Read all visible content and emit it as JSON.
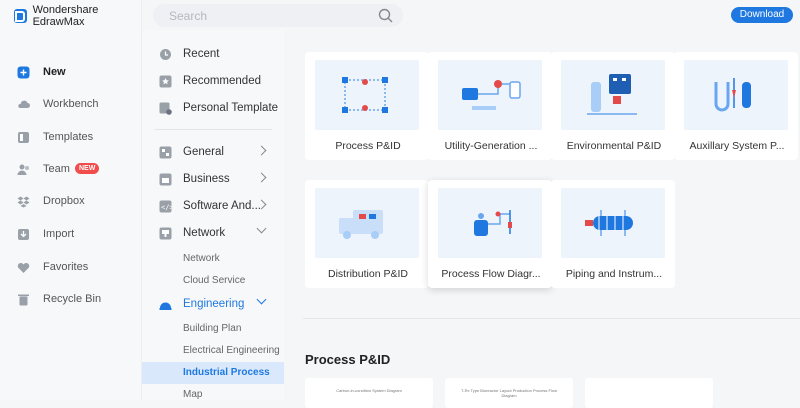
{
  "app": {
    "name": "Wondershare EdrawMax"
  },
  "leftnav": {
    "items": [
      {
        "label": "New",
        "icon": "plus-square-icon",
        "active": true
      },
      {
        "label": "Workbench",
        "icon": "cloud-icon"
      },
      {
        "label": "Templates",
        "icon": "template-icon"
      },
      {
        "label": "Team",
        "icon": "team-icon",
        "badge": "NEW"
      },
      {
        "label": "Dropbox",
        "icon": "dropbox-icon"
      },
      {
        "label": "Import",
        "icon": "import-icon"
      },
      {
        "label": "Favorites",
        "icon": "heart-icon"
      },
      {
        "label": "Recycle Bin",
        "icon": "trash-icon"
      }
    ]
  },
  "search": {
    "placeholder": "Search"
  },
  "download": {
    "label": "Download"
  },
  "categories": {
    "top": [
      {
        "label": "Recent",
        "icon": "clock-icon"
      },
      {
        "label": "Recommended",
        "icon": "star-icon"
      },
      {
        "label": "Personal Template",
        "icon": "personal-template-icon"
      }
    ],
    "groups": [
      {
        "label": "General",
        "icon": "general-icon"
      },
      {
        "label": "Business",
        "icon": "business-icon"
      },
      {
        "label": "Software And...",
        "icon": "software-icon"
      },
      {
        "label": "Network",
        "icon": "network-icon"
      }
    ],
    "network_subs": [
      "Network",
      "Cloud Service"
    ],
    "engineering": {
      "label": "Engineering",
      "icon": "engineering-icon"
    },
    "engineering_subs": [
      "Building Plan",
      "Electrical Engineering",
      "Industrial Process",
      "Map"
    ],
    "active_sub": "Industrial Process"
  },
  "templates": [
    {
      "title": "Process P&ID"
    },
    {
      "title": "Utility-Generation ..."
    },
    {
      "title": "Environmental P&ID"
    },
    {
      "title": "Auxillary System P..."
    },
    {
      "title": "Distribution P&ID"
    },
    {
      "title": "Process Flow Diagr..."
    },
    {
      "title": "Piping and Instrum..."
    }
  ],
  "section": {
    "title": "Process P&ID"
  },
  "examples": [
    {
      "title": "Carbon-in-condition System Diagram"
    },
    {
      "title": "T-Rx Type Bioreactor Layout Production Process Flow Diagram"
    },
    {
      "title": ""
    }
  ],
  "colors": {
    "accent": "#1e78e0",
    "badge": "#f24d4d",
    "active_bg": "#d9e9fb"
  }
}
